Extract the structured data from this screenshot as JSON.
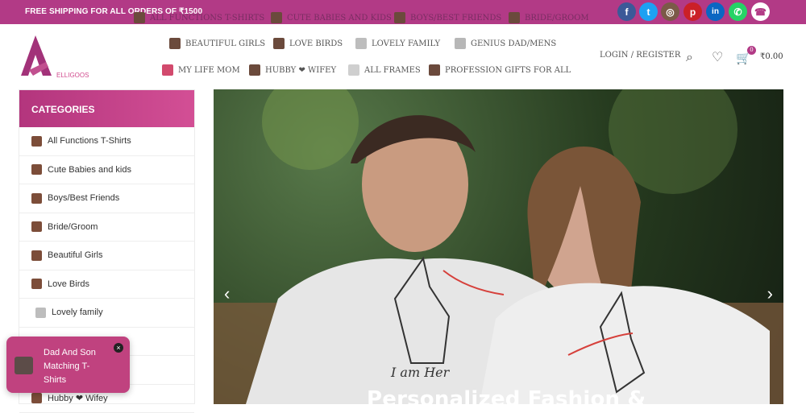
{
  "topbar": {
    "shipping": "FREE SHIPPING FOR ALL ORDERS OF ₹1500",
    "top_nav": [
      "ALL FUNCTIONS T-SHIRTS",
      "CUTE BABIES AND KIDS",
      "BOYS/BEST FRIENDS",
      "BRIDE/GROOM"
    ],
    "social": [
      {
        "name": "facebook",
        "glyph": "f",
        "color": "#3b5998"
      },
      {
        "name": "twitter",
        "glyph": "t",
        "color": "#1da1f2"
      },
      {
        "name": "instagram",
        "glyph": "◎",
        "color": "#7b5a48"
      },
      {
        "name": "pinterest",
        "glyph": "p",
        "color": "#cb2027"
      },
      {
        "name": "linkedin",
        "glyph": "in",
        "color": "#0a66c2"
      },
      {
        "name": "whatsapp",
        "glyph": "✆",
        "color": "#25d366"
      },
      {
        "name": "phone",
        "glyph": "☎",
        "color": "#ffffff"
      }
    ]
  },
  "header": {
    "nav_row1": [
      "BEAUTIFUL GIRLS",
      "LOVE BIRDS",
      "LOVELY FAMILY",
      "GENIUS DAD/MENS"
    ],
    "nav_row2": [
      "MY LIFE MOM",
      "HUBBY ❤ WIFEY",
      "ALL FRAMES",
      "PROFESSION GIFTS FOR ALL"
    ],
    "login": "LOGIN / REGISTER",
    "cart_count": "0",
    "cart_total": "₹0.00"
  },
  "categories": {
    "title": "CATEGORIES",
    "items": [
      "All Functions T-Shirts",
      "Cute Babies and kids",
      "Boys/Best Friends",
      "Bride/Groom",
      "Beautiful Girls",
      "Love Birds",
      "Lovely family",
      "",
      "",
      "Hubby ❤ Wifey"
    ]
  },
  "hero": {
    "title": "Personalized Fashion &"
  },
  "popup": {
    "text": "Dad And Son Matching T-Shirts"
  }
}
